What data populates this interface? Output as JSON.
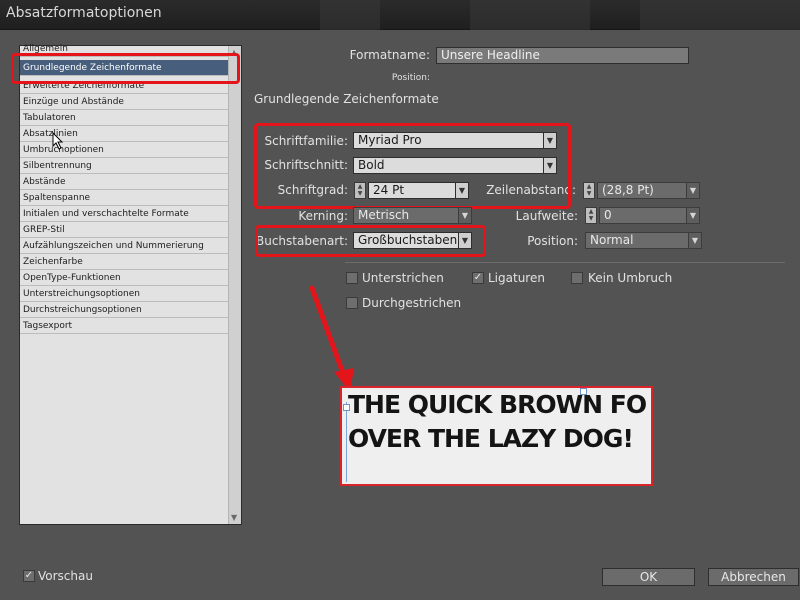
{
  "window": {
    "title": "Absatzformatoptionen"
  },
  "categories": [
    "Allgemein",
    "Grundlegende Zeichenformate",
    "Erweiterte Zeichenformate",
    "Einzüge und Abstände",
    "Tabulatoren",
    "Absatzlinien",
    "Umbruchoptionen",
    "Silbentrennung",
    "Abstände",
    "Spaltenspanne",
    "Initialen und verschachtelte Formate",
    "GREP-Stil",
    "Aufzählungszeichen und Nummerierung",
    "Zeichenfarbe",
    "OpenType-Funktionen",
    "Unterstreichungsoptionen",
    "Durchstreichungsoptionen",
    "Tagsexport"
  ],
  "selected_category": "Grundlegende Zeichenformate",
  "form": {
    "formatname_label": "Formatname:",
    "formatname_value": "Unsere Headline",
    "position_label": "Position:",
    "section_title": "Grundlegende Zeichenformate",
    "schriftfamilie_label": "Schriftfamilie:",
    "schriftfamilie_value": "Myriad Pro",
    "schriftschnitt_label": "Schriftschnitt:",
    "schriftschnitt_value": "Bold",
    "schriftgrad_label": "Schriftgrad:",
    "schriftgrad_value": "24 Pt",
    "zeilenabstand_label": "Zeilenabstand:",
    "zeilenabstand_value": "(28,8 Pt)",
    "kerning_label": "Kerning:",
    "kerning_value": "Metrisch",
    "laufweite_label": "Laufweite:",
    "laufweite_value": "0",
    "buchstabenart_label": "Buchstabenart:",
    "buchstabenart_value": "Großbuchstaben",
    "position2_label": "Position:",
    "position2_value": "Normal"
  },
  "checkboxes": {
    "unterstrichen": {
      "label": "Unterstrichen",
      "checked": false
    },
    "ligaturen": {
      "label": "Ligaturen",
      "checked": true
    },
    "kein_umbruch": {
      "label": "Kein Umbruch",
      "checked": false
    },
    "durchgestrichen": {
      "label": "Durchgestrichen",
      "checked": false
    }
  },
  "preview": {
    "line1": "THE QUICK BROWN FO",
    "line2": "OVER THE LAZY DOG!"
  },
  "footer": {
    "vorschau_label": "Vorschau",
    "vorschau_checked": true,
    "ok_label": "OK",
    "cancel_label": "Abbrechen"
  },
  "colors": {
    "highlight": "#e3151b",
    "selection": "#475f7c",
    "dialog_bg": "#535353"
  }
}
